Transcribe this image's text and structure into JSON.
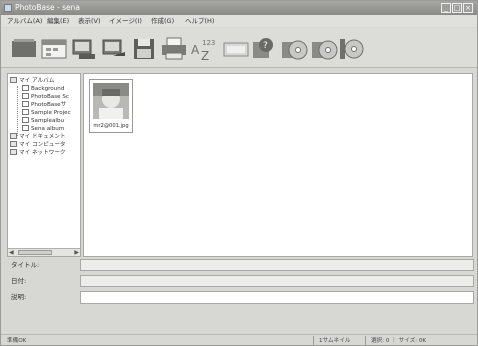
{
  "window": {
    "title": "PhotoBase - sena"
  },
  "menu": [
    "アルバム(A)",
    "編集(E)",
    "表示(V)",
    "イメージ(I)",
    "作成(G)",
    "ヘルプ(H)"
  ],
  "tree": {
    "root_label": "マイ アルバム",
    "albums": [
      "Background",
      "PhotoBase Sc",
      "PhotoBaseサ",
      "Sample Projec",
      "Samplealbu",
      "Sena album"
    ],
    "others": [
      "マイ ドキュメント",
      "マイ コンピュータ",
      "マイ ネットワーク"
    ]
  },
  "thumbnail": {
    "filename": "mr2@001.jpg"
  },
  "fields": {
    "title_label": "タイトル:",
    "date_label": "日付:",
    "desc_label": "説明:"
  },
  "status": {
    "left": "準備OK",
    "thumb": "1サムネイル",
    "selected": "選択: 0 ｜ サイズ: 0K"
  },
  "icons": [
    "album-icon",
    "calendar-icon",
    "import-icon",
    "export-icon",
    "save-icon",
    "print-icon",
    "sort-az-icon",
    "slideshow-icon",
    "search-icon",
    "cd-burn-icon",
    "cd-write-icon",
    "dvd-icon"
  ],
  "colors": {
    "titlebar": "#8a8a86",
    "window": "#d7d7d3",
    "panel": "#ffffff"
  }
}
